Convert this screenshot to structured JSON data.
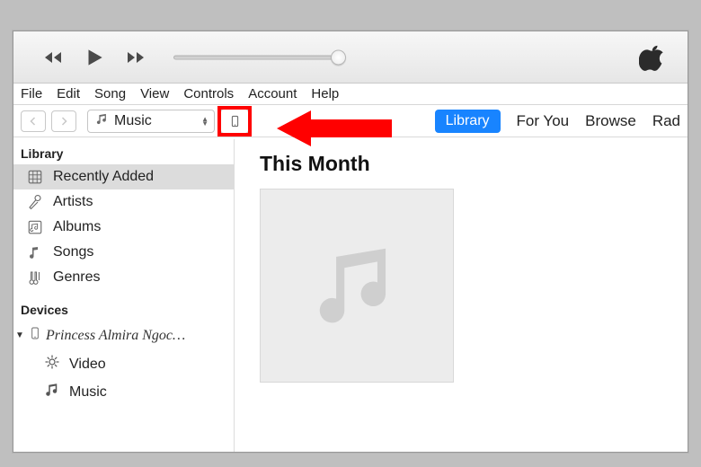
{
  "menu": [
    "File",
    "Edit",
    "Song",
    "View",
    "Controls",
    "Account",
    "Help"
  ],
  "media_picker": {
    "label": "Music"
  },
  "nav_tabs": {
    "library": "Library",
    "for_you": "For You",
    "browse": "Browse",
    "radio_truncated": "Rad"
  },
  "sidebar": {
    "library_heading": "Library",
    "library_items": [
      {
        "label": "Recently Added"
      },
      {
        "label": "Artists"
      },
      {
        "label": "Albums"
      },
      {
        "label": "Songs"
      },
      {
        "label": "Genres"
      }
    ],
    "devices_heading": "Devices",
    "device_name": "Princess Almira Ngoc…",
    "device_children": [
      {
        "label": "Video"
      },
      {
        "label": "Music"
      }
    ]
  },
  "content": {
    "section_title": "This Month"
  },
  "colors": {
    "accent": "#1884ff",
    "annotation": "#ff0000"
  }
}
